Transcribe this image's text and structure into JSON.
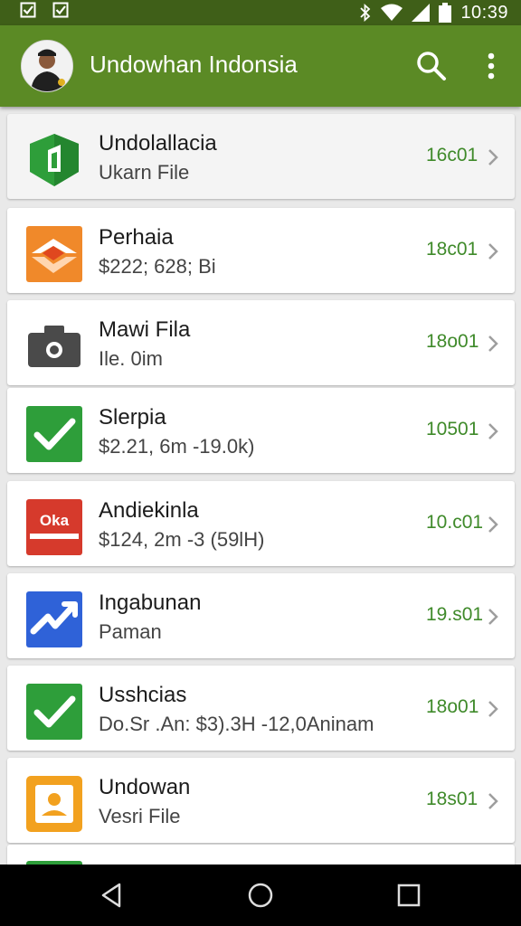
{
  "status_bar": {
    "time": "10:39"
  },
  "app_bar": {
    "title": "Undowhan Indonsia"
  },
  "items": [
    {
      "title": "Undolallacia",
      "subtitle": "Ukarn File",
      "count": "16c01",
      "icon": "shield-icon",
      "color": "#2e9e3a"
    },
    {
      "title": "Perhaia",
      "subtitle": "$222; 628; Bi",
      "count": "18c01",
      "icon": "transfer-icon",
      "color": "#f0892a"
    },
    {
      "title": "Mawi Fila",
      "subtitle": "Ile. 0im",
      "count": "18o01",
      "icon": "camera-icon",
      "color": "#4a4a4a"
    },
    {
      "title": "Slerpia",
      "subtitle": "$2.21, 6m -19.0k)",
      "count": "10501",
      "icon": "check-icon",
      "color": "#2e9e3a"
    },
    {
      "title": "Andiekinla",
      "subtitle": "$124, 2m -3 (59lH)",
      "count": "10.c01",
      "icon": "brand-badge-icon",
      "color": "#d63a2c",
      "badge_text": "Oka"
    },
    {
      "title": "Ingabunan",
      "subtitle": "Paman",
      "count": "19.s01",
      "icon": "trend-icon",
      "color": "#2f62d8"
    },
    {
      "title": "Usshcias",
      "subtitle": "Do.Sr .An: $3).3H -12,0Aninam",
      "count": "18o01",
      "icon": "check-icon",
      "color": "#2e9e3a"
    },
    {
      "title": "Undowan",
      "subtitle": "Vesri File",
      "count": "18s01",
      "icon": "person-icon",
      "color": "#f2a11f"
    }
  ],
  "colors": {
    "status_bar": "#3f5f18",
    "app_bar": "#5b8a25",
    "count_text": "#3f8a2a"
  }
}
